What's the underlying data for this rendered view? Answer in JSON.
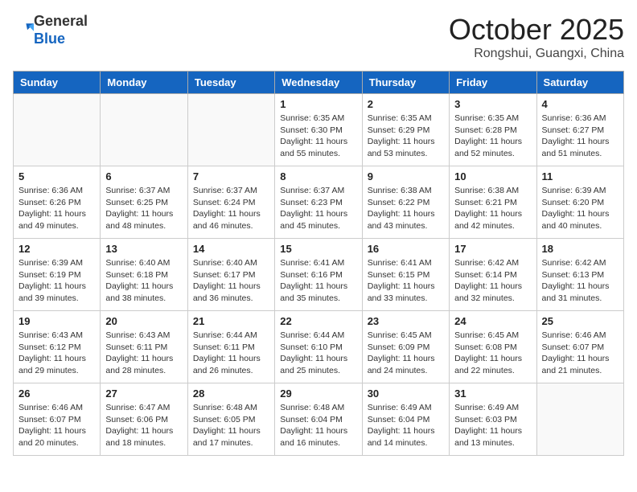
{
  "header": {
    "logo_line1": "General",
    "logo_line2": "Blue",
    "month": "October 2025",
    "location": "Rongshui, Guangxi, China"
  },
  "weekdays": [
    "Sunday",
    "Monday",
    "Tuesday",
    "Wednesday",
    "Thursday",
    "Friday",
    "Saturday"
  ],
  "weeks": [
    [
      {
        "day": "",
        "info": ""
      },
      {
        "day": "",
        "info": ""
      },
      {
        "day": "",
        "info": ""
      },
      {
        "day": "1",
        "info": "Sunrise: 6:35 AM\nSunset: 6:30 PM\nDaylight: 11 hours and 55 minutes."
      },
      {
        "day": "2",
        "info": "Sunrise: 6:35 AM\nSunset: 6:29 PM\nDaylight: 11 hours and 53 minutes."
      },
      {
        "day": "3",
        "info": "Sunrise: 6:35 AM\nSunset: 6:28 PM\nDaylight: 11 hours and 52 minutes."
      },
      {
        "day": "4",
        "info": "Sunrise: 6:36 AM\nSunset: 6:27 PM\nDaylight: 11 hours and 51 minutes."
      }
    ],
    [
      {
        "day": "5",
        "info": "Sunrise: 6:36 AM\nSunset: 6:26 PM\nDaylight: 11 hours and 49 minutes."
      },
      {
        "day": "6",
        "info": "Sunrise: 6:37 AM\nSunset: 6:25 PM\nDaylight: 11 hours and 48 minutes."
      },
      {
        "day": "7",
        "info": "Sunrise: 6:37 AM\nSunset: 6:24 PM\nDaylight: 11 hours and 46 minutes."
      },
      {
        "day": "8",
        "info": "Sunrise: 6:37 AM\nSunset: 6:23 PM\nDaylight: 11 hours and 45 minutes."
      },
      {
        "day": "9",
        "info": "Sunrise: 6:38 AM\nSunset: 6:22 PM\nDaylight: 11 hours and 43 minutes."
      },
      {
        "day": "10",
        "info": "Sunrise: 6:38 AM\nSunset: 6:21 PM\nDaylight: 11 hours and 42 minutes."
      },
      {
        "day": "11",
        "info": "Sunrise: 6:39 AM\nSunset: 6:20 PM\nDaylight: 11 hours and 40 minutes."
      }
    ],
    [
      {
        "day": "12",
        "info": "Sunrise: 6:39 AM\nSunset: 6:19 PM\nDaylight: 11 hours and 39 minutes."
      },
      {
        "day": "13",
        "info": "Sunrise: 6:40 AM\nSunset: 6:18 PM\nDaylight: 11 hours and 38 minutes."
      },
      {
        "day": "14",
        "info": "Sunrise: 6:40 AM\nSunset: 6:17 PM\nDaylight: 11 hours and 36 minutes."
      },
      {
        "day": "15",
        "info": "Sunrise: 6:41 AM\nSunset: 6:16 PM\nDaylight: 11 hours and 35 minutes."
      },
      {
        "day": "16",
        "info": "Sunrise: 6:41 AM\nSunset: 6:15 PM\nDaylight: 11 hours and 33 minutes."
      },
      {
        "day": "17",
        "info": "Sunrise: 6:42 AM\nSunset: 6:14 PM\nDaylight: 11 hours and 32 minutes."
      },
      {
        "day": "18",
        "info": "Sunrise: 6:42 AM\nSunset: 6:13 PM\nDaylight: 11 hours and 31 minutes."
      }
    ],
    [
      {
        "day": "19",
        "info": "Sunrise: 6:43 AM\nSunset: 6:12 PM\nDaylight: 11 hours and 29 minutes."
      },
      {
        "day": "20",
        "info": "Sunrise: 6:43 AM\nSunset: 6:11 PM\nDaylight: 11 hours and 28 minutes."
      },
      {
        "day": "21",
        "info": "Sunrise: 6:44 AM\nSunset: 6:11 PM\nDaylight: 11 hours and 26 minutes."
      },
      {
        "day": "22",
        "info": "Sunrise: 6:44 AM\nSunset: 6:10 PM\nDaylight: 11 hours and 25 minutes."
      },
      {
        "day": "23",
        "info": "Sunrise: 6:45 AM\nSunset: 6:09 PM\nDaylight: 11 hours and 24 minutes."
      },
      {
        "day": "24",
        "info": "Sunrise: 6:45 AM\nSunset: 6:08 PM\nDaylight: 11 hours and 22 minutes."
      },
      {
        "day": "25",
        "info": "Sunrise: 6:46 AM\nSunset: 6:07 PM\nDaylight: 11 hours and 21 minutes."
      }
    ],
    [
      {
        "day": "26",
        "info": "Sunrise: 6:46 AM\nSunset: 6:07 PM\nDaylight: 11 hours and 20 minutes."
      },
      {
        "day": "27",
        "info": "Sunrise: 6:47 AM\nSunset: 6:06 PM\nDaylight: 11 hours and 18 minutes."
      },
      {
        "day": "28",
        "info": "Sunrise: 6:48 AM\nSunset: 6:05 PM\nDaylight: 11 hours and 17 minutes."
      },
      {
        "day": "29",
        "info": "Sunrise: 6:48 AM\nSunset: 6:04 PM\nDaylight: 11 hours and 16 minutes."
      },
      {
        "day": "30",
        "info": "Sunrise: 6:49 AM\nSunset: 6:04 PM\nDaylight: 11 hours and 14 minutes."
      },
      {
        "day": "31",
        "info": "Sunrise: 6:49 AM\nSunset: 6:03 PM\nDaylight: 11 hours and 13 minutes."
      },
      {
        "day": "",
        "info": ""
      }
    ]
  ]
}
